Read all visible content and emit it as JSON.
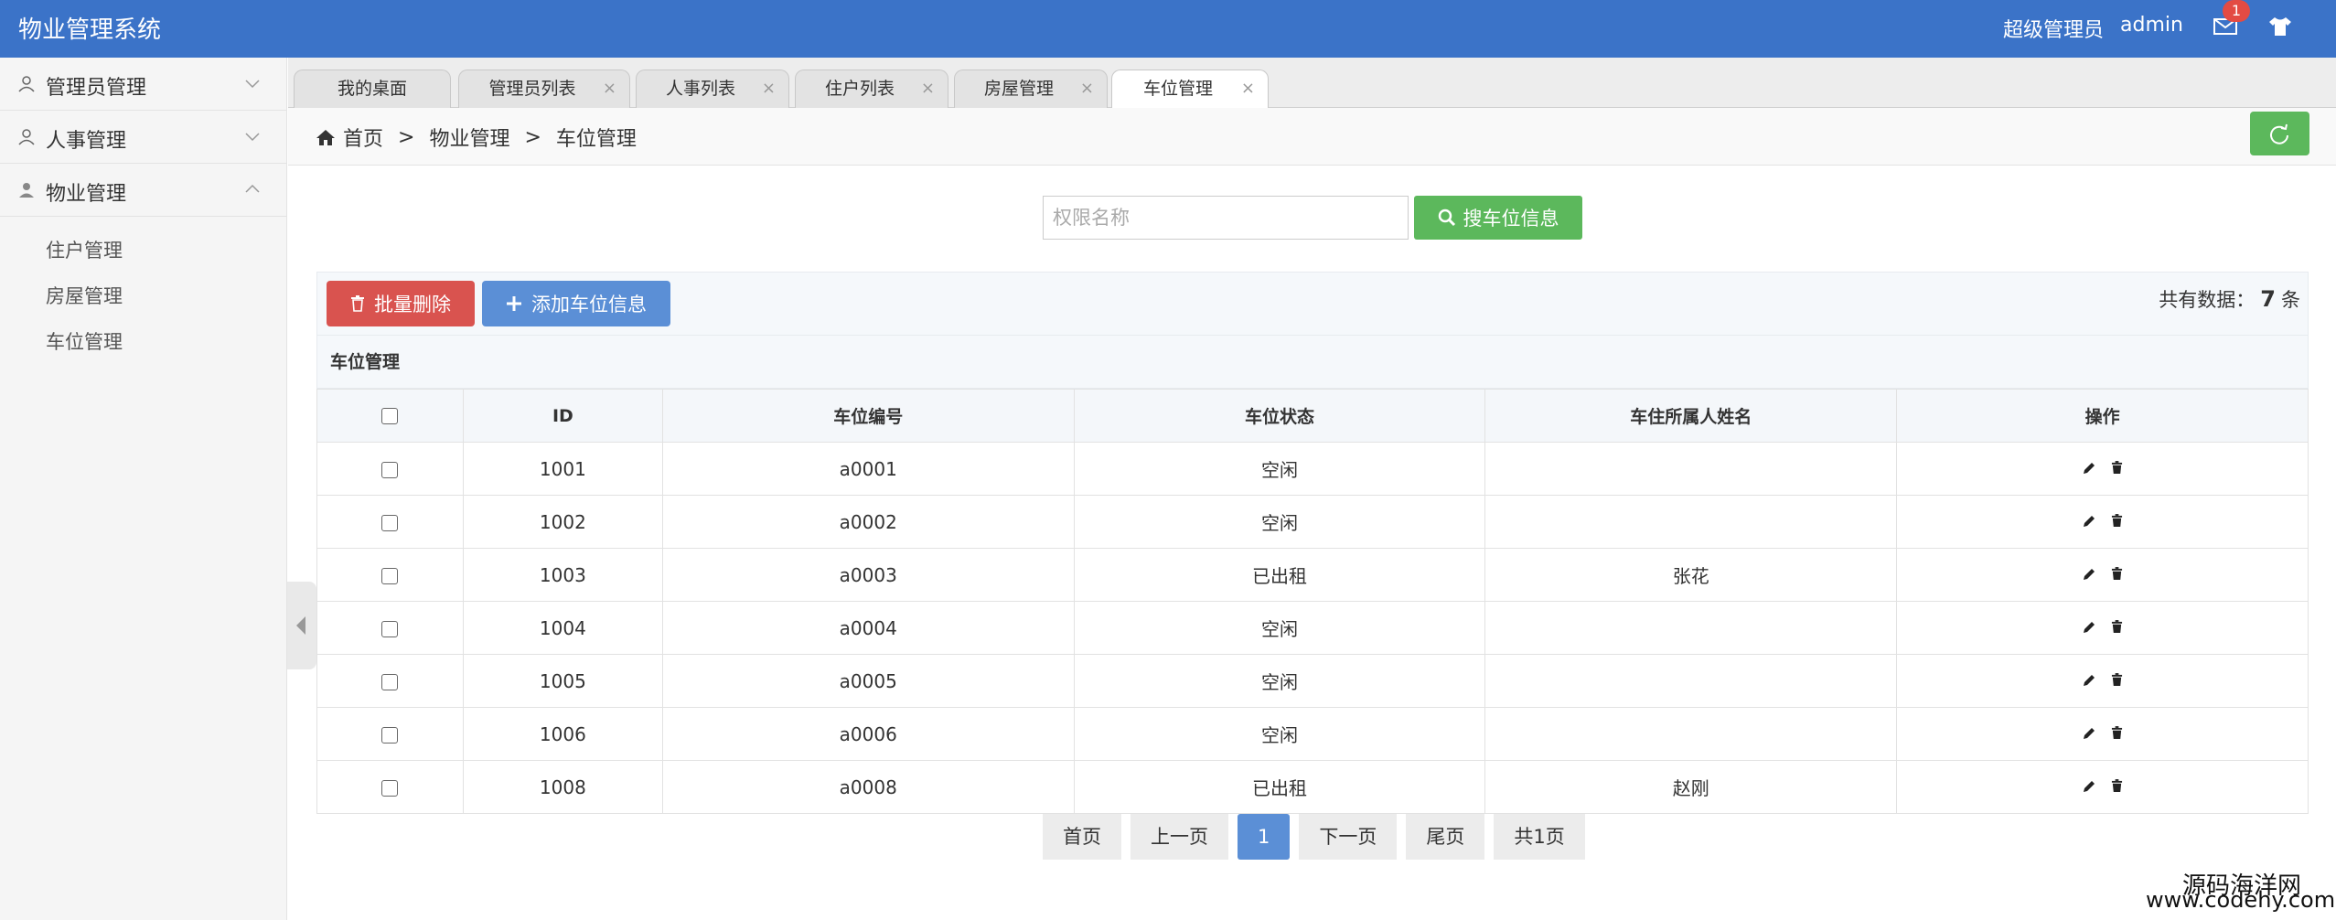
{
  "app": {
    "title": "物业管理系统",
    "role": "超级管理员",
    "user": "admin",
    "mail_count": "1"
  },
  "sidebar": {
    "groups": [
      {
        "label": "管理员管理"
      },
      {
        "label": "人事管理"
      },
      {
        "label": "物业管理"
      }
    ],
    "sub_items": [
      "住户管理",
      "房屋管理",
      "车位管理"
    ]
  },
  "tabs": [
    {
      "label": "我的桌面"
    },
    {
      "label": "管理员列表"
    },
    {
      "label": "人事列表"
    },
    {
      "label": "住户列表"
    },
    {
      "label": "房屋管理"
    },
    {
      "label": "车位管理"
    }
  ],
  "breadcrumb": {
    "home": "首页",
    "sep": ">",
    "level1": "物业管理",
    "level2": "车位管理"
  },
  "search": {
    "placeholder": "权限名称",
    "value": "",
    "button": "搜车位信息"
  },
  "toolbar": {
    "delete_label": "批量删除",
    "add_label": "添加车位信息",
    "total_prefix": "共有数据：",
    "total_count": "7",
    "total_suffix": "条"
  },
  "table": {
    "caption": "车位管理",
    "headers": [
      "ID",
      "车位编号",
      "车位状态",
      "车住所属人姓名",
      "操作"
    ],
    "rows": [
      {
        "id": "1001",
        "code": "a0001",
        "status": "空闲",
        "owner": ""
      },
      {
        "id": "1002",
        "code": "a0002",
        "status": "空闲",
        "owner": ""
      },
      {
        "id": "1003",
        "code": "a0003",
        "status": "已出租",
        "owner": "张花"
      },
      {
        "id": "1004",
        "code": "a0004",
        "status": "空闲",
        "owner": ""
      },
      {
        "id": "1005",
        "code": "a0005",
        "status": "空闲",
        "owner": ""
      },
      {
        "id": "1006",
        "code": "a0006",
        "status": "空闲",
        "owner": ""
      },
      {
        "id": "1008",
        "code": "a0008",
        "status": "已出租",
        "owner": "赵刚"
      }
    ]
  },
  "pager": {
    "first": "首页",
    "prev": "上一页",
    "current": "1",
    "next": "下一页",
    "last": "尾页",
    "total": "共1页"
  },
  "watermark": {
    "line1": "源码海洋网",
    "line2": "www.codehy.com"
  },
  "colors": {
    "topbar": "#3b73c8",
    "success": "#5cb85c",
    "danger": "#d9534f",
    "primary": "#5b8fd6"
  }
}
